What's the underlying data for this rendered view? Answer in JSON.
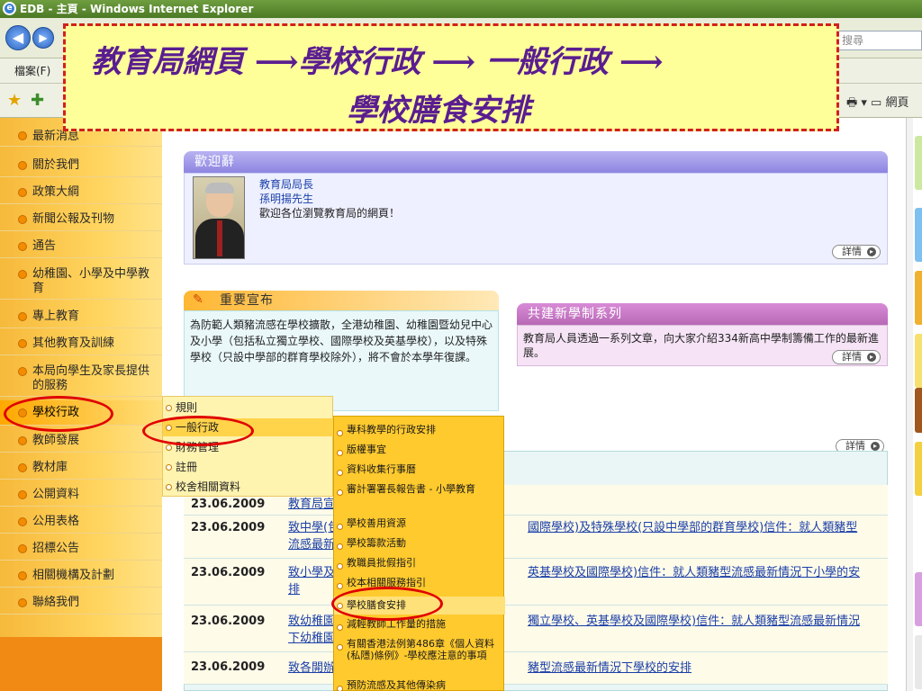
{
  "window": {
    "title": "EDB - 主頁 - Windows Internet Explorer"
  },
  "browser": {
    "search_placeholder": "搜尋",
    "menu_file": "檔案(F)",
    "tool_right_label": "網頁"
  },
  "callout": {
    "line1": "教育局網頁 ⟶學校行政 ⟶ 一般行政 ⟶",
    "line2": "學校膳食安排"
  },
  "sidebar": {
    "items": [
      "最新消息",
      "關於我們",
      "政策大綱",
      "新聞公報及刊物",
      "通告",
      "幼稚園、小學及中學教育",
      "專上教育",
      "其他教育及訓練",
      "本局向學生及家長提供的服務",
      "學校行政",
      "教師發展",
      "教材庫",
      "公開資料",
      "公用表格",
      "招標公告",
      "相關機構及計劃",
      "聯絡我們"
    ]
  },
  "submenu1": {
    "items": [
      "規則",
      "一般行政",
      "財務管理",
      "註冊",
      "校舍相關資料"
    ]
  },
  "submenu2": {
    "items": [
      "專科教學的行政安排",
      "版權事宜",
      "資料收集行事曆",
      "審計署署長報告書 - 小學教育",
      "學校善用資源",
      "學校籌款活動",
      "教職員批假指引",
      "校本相關服務指引",
      "學校膳食安排",
      "減輕教師工作量的措施",
      "有關香港法例第486章《個人資料(私隱)條例》-學校應注意的事項",
      "預防流感及其他傳染病"
    ]
  },
  "welcome": {
    "heading": "歡迎辭",
    "title": "教育局局長",
    "name": "孫明揚先生",
    "message": "歡迎各位瀏覽教育局的網頁！",
    "detail": "詳情"
  },
  "notice": {
    "heading": "重要宣布",
    "text": "為防範人類豬流感在學校擴散，全港幼稚園、幼稚園暨幼兒中心及小學（包括私立獨立學校、國際學校及英基學校），以及特殊學校（只設中學部的群育學校除外），將不會於本學年復課。"
  },
  "series": {
    "heading": "共建新學制系列",
    "text": "教育局人員透過一系列文章，向大家介紹334新高中學制籌備工作的最新進展。",
    "detail": "詳情"
  },
  "news": {
    "detail": "詳情",
    "rows": [
      {
        "date": "23.06.2009",
        "text_a": "教育局宣布",
        "text_b": ""
      },
      {
        "date": "23.06.2009",
        "text_a": "致中學(包括",
        "text_a2": "流感最新情",
        "text_b": "國際學校)及特殊學校(只設中學部的群育學校)信件：就人類豬型"
      },
      {
        "date": "23.06.2009",
        "text_a": "致小學及特",
        "text_a2": "排",
        "text_b": "英基學校及國際學校)信件：就人類豬型流感最新情況下小學的安"
      },
      {
        "date": "23.06.2009",
        "text_a": "致幼稚園及",
        "text_a2": "下幼稚園及",
        "text_b": "獨立學校、英基學校及國際學校)信件：就人類豬型流感最新情況"
      },
      {
        "date": "23.06.2009",
        "text_a": "致各開辦補",
        "text_b": "豬型流感最新情況下學校的安排"
      }
    ]
  }
}
